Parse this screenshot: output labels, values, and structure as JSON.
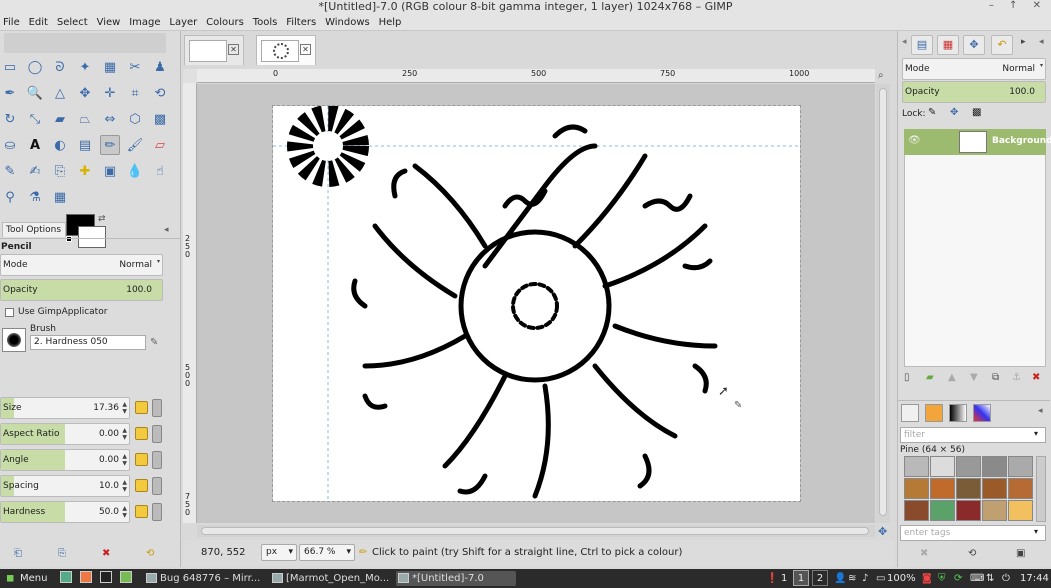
{
  "window": {
    "title": "*[Untitled]-7.0 (RGB colour 8-bit gamma integer, 1 layer) 1024x768 – GIMP",
    "controls": "– ↑ ✕"
  },
  "menu": [
    "File",
    "Edit",
    "Select",
    "View",
    "Image",
    "Layer",
    "Colours",
    "Tools",
    "Filters",
    "Windows",
    "Help"
  ],
  "tool_options": {
    "tab_label": "Tool Options",
    "tool_name": "Pencil",
    "mode": {
      "label": "Mode",
      "value": "Normal"
    },
    "opacity": {
      "label": "Opacity",
      "value": "100.0",
      "fraction": 1.0
    },
    "use_applicator": "Use GimpApplicator",
    "brush_label": "Brush",
    "brush_name": "2. Hardness 050",
    "sliders": [
      {
        "label": "Size",
        "value": "17.36",
        "fraction": 0.1
      },
      {
        "label": "Aspect Ratio",
        "value": "0.00",
        "fraction": 0.5
      },
      {
        "label": "Angle",
        "value": "0.00",
        "fraction": 0.5
      },
      {
        "label": "Spacing",
        "value": "10.0",
        "fraction": 0.1
      },
      {
        "label": "Hardness",
        "value": "50.0",
        "fraction": 0.5
      }
    ]
  },
  "ruler": {
    "h_ticks": [
      "0",
      "250",
      "500",
      "750",
      "1000"
    ],
    "v_ticks": [
      "2 5 0",
      "5 0 0",
      "7 5 0"
    ]
  },
  "status": {
    "coords": "870, 552",
    "unit": "px",
    "zoom": "66.7 %",
    "message": "Click to paint (try Shift for a straight line, Ctrl to pick a colour)"
  },
  "layers": {
    "mode_label": "Mode",
    "mode_value": "Normal",
    "opacity_label": "Opacity",
    "opacity_value": "100.0",
    "lock_label": "Lock:",
    "layer_name": "Background"
  },
  "brushes": {
    "filter_placeholder": "filter",
    "brush_title": "Pine (64 × 56)",
    "tags_placeholder": "enter tags"
  },
  "taskbar": {
    "menu_label": "Menu",
    "tasks": [
      "Bug 648776 – Mirr...",
      "[Marmot_Open_Mo...",
      "*[Untitled]-7.0 (RGB..."
    ],
    "workspaces": [
      "1",
      "1",
      "2"
    ],
    "battery": "100%",
    "clock": "17:44"
  },
  "colors": {
    "layer_selected": "#9dbb6e",
    "slider_fill": "#c7dca6",
    "accent": "#3a6aa8"
  }
}
